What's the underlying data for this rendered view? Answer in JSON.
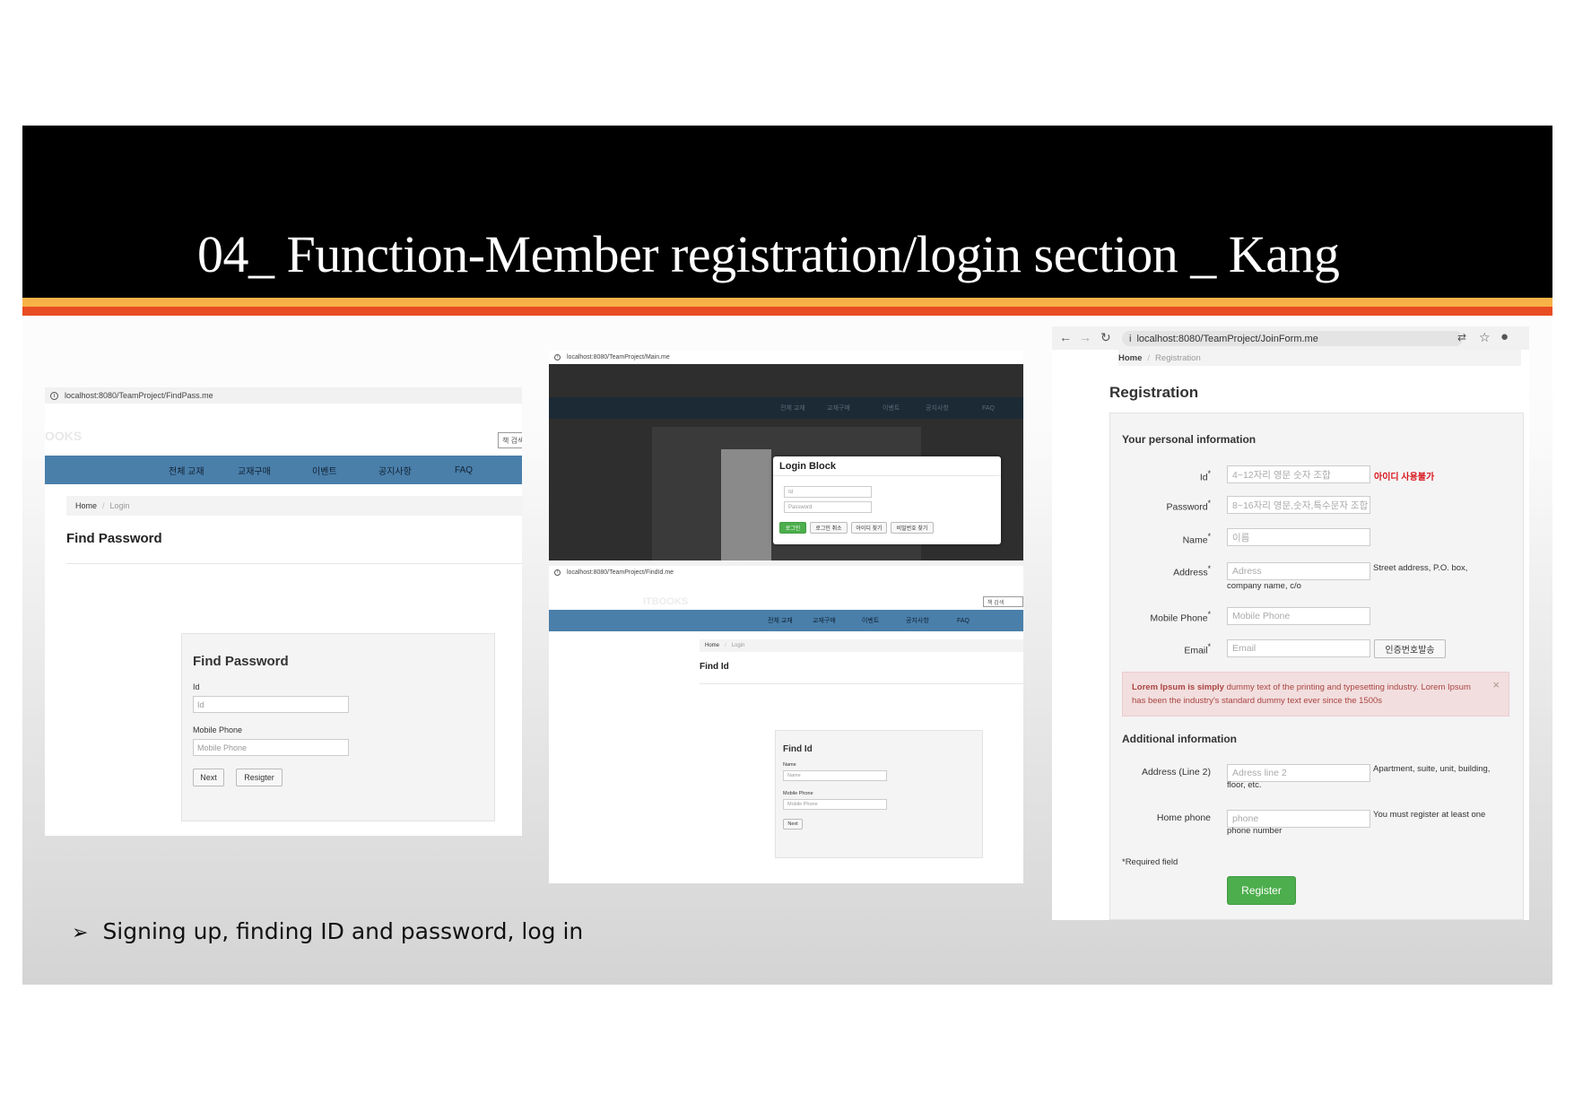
{
  "slide": {
    "title": "04_ Function-Member registration/login section _ Kang",
    "bullet_arrow": "➢",
    "bullet": "Signing up, finding ID and password, log in",
    "colors": {
      "header": "#000000",
      "stripe_top": "#f7b247",
      "stripe_bottom": "#e84c22",
      "nav": "#4a7faa",
      "green": "#4cae4c"
    }
  },
  "find_password": {
    "url": "localhost:8080/TeamProject/FindPass.me",
    "logo": "OOKS",
    "search_placeholder": "책 검색",
    "nav": [
      "전체 교재",
      "교재구매",
      "이벤트",
      "공지사항",
      "FAQ"
    ],
    "breadcrumb": {
      "home": "Home",
      "sep": "/",
      "current": "Login"
    },
    "heading": "Find Password",
    "card": {
      "title": "Find Password",
      "id_label": "Id",
      "id_placeholder": "Id",
      "phone_label": "Mobile Phone",
      "phone_placeholder": "Mobile Phone",
      "next": "Next",
      "register": "Resigter"
    }
  },
  "login": {
    "url": "localhost:8080/TeamProject/Main.me",
    "nav": [
      "전체 교재",
      "교재구매",
      "이벤트",
      "공지사항",
      "FAQ"
    ],
    "modal_title": "Login Block",
    "id_placeholder": "Id",
    "password_placeholder": "Password",
    "buttons": [
      "로그인",
      "로그인 취소",
      "아이디 찾기",
      "비밀번호 찾기"
    ]
  },
  "find_id": {
    "url": "localhost:8080/TeamProject/FindId.me",
    "logo": "ITBOOKS",
    "search_placeholder": "책 검색",
    "nav": [
      "전체 교재",
      "교재구매",
      "이벤트",
      "공지사항",
      "FAQ"
    ],
    "breadcrumb": {
      "home": "Home",
      "sep": "/",
      "current": "Login"
    },
    "heading": "Find Id",
    "card": {
      "title": "Find Id",
      "name_label": "Name",
      "name_placeholder": "Name",
      "phone_label": "Mobile Phone",
      "phone_placeholder": "Mobile Phone",
      "next": "Next"
    }
  },
  "registration": {
    "url": "localhost:8080/TeamProject/JoinForm.me",
    "icons": [
      "back-icon",
      "forward-icon",
      "reload-icon",
      "info-icon",
      "translate-icon",
      "star-icon",
      "account-icon"
    ],
    "breadcrumb": {
      "home": "Home",
      "sep": "/",
      "current": "Registration"
    },
    "heading": "Registration",
    "personal_title": "Your personal information",
    "fields": {
      "id": {
        "label": "Id",
        "req": "*",
        "placeholder": "4~12자리 영문 숫자 조합",
        "error": "아이디 사용불가"
      },
      "password": {
        "label": "Password",
        "req": "*",
        "placeholder": "8~16자리 영문,숫자,특수문자 조합"
      },
      "name": {
        "label": "Name",
        "req": "*",
        "placeholder": "이름"
      },
      "address": {
        "label": "Address",
        "req": "*",
        "placeholder": "Adress",
        "help1": "Street address, P.O. box,",
        "help2": "company name, c/o"
      },
      "mobile": {
        "label": "Mobile Phone",
        "req": "*",
        "placeholder": "Mobile Phone"
      },
      "email": {
        "label": "Email",
        "req": "*",
        "placeholder": "Email",
        "button": "인증번호발송"
      }
    },
    "alert": {
      "bold": "Lorem Ipsum is simply",
      "text1": " dummy text of the printing and typesetting industry. Lorem Ipsum",
      "text2": "has been the industry's standard dummy text ever since the 1500s",
      "close": "×"
    },
    "additional_title": "Additional information",
    "address2": {
      "label": "Address (Line 2)",
      "placeholder": "Adress line 2",
      "help1": "Apartment, suite, unit, building,",
      "help2": "floor, etc."
    },
    "home_phone": {
      "label": "Home phone",
      "placeholder": "phone",
      "help1": "You must register at least one",
      "help2": "phone number"
    },
    "required_note": "*Required field",
    "register": "Register"
  }
}
